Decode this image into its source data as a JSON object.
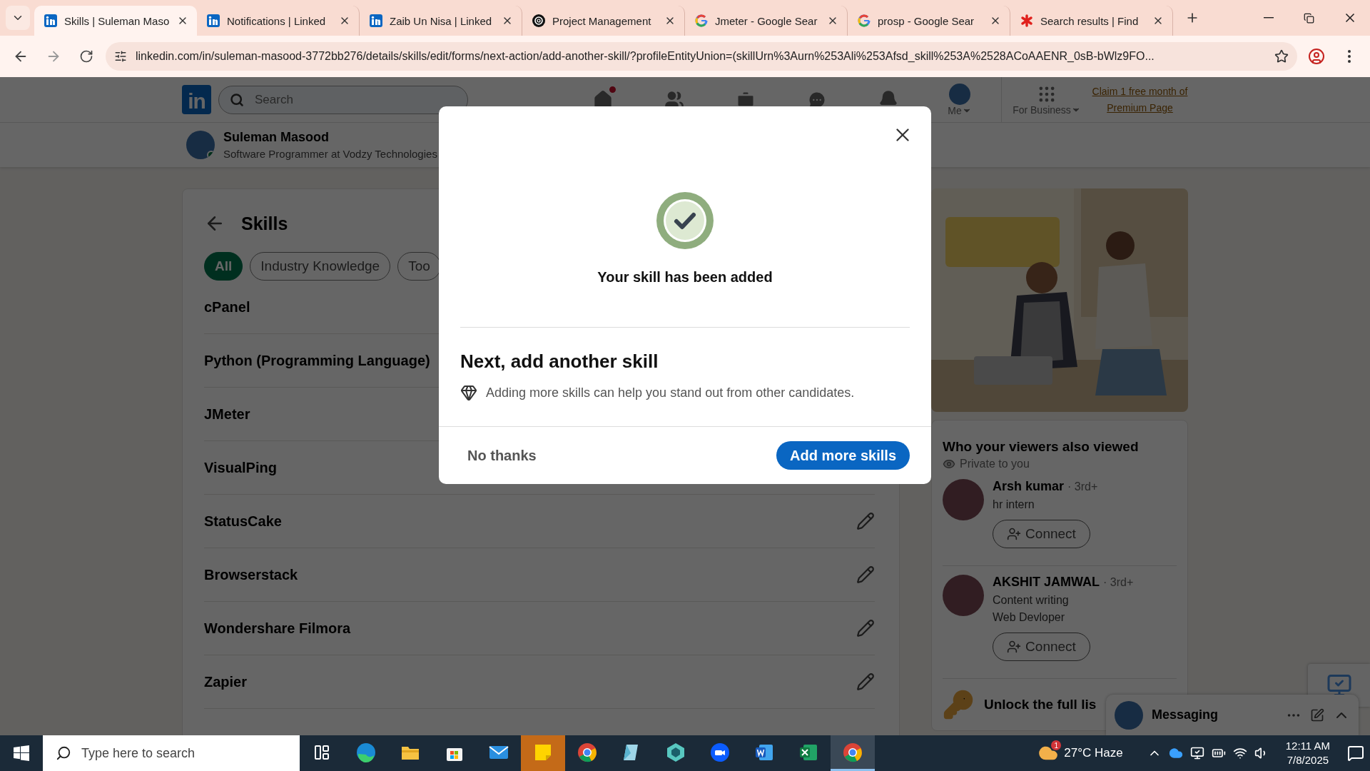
{
  "browser": {
    "tabs": [
      {
        "title": "Skills | Suleman Maso",
        "kind": "linkedin",
        "selected": true
      },
      {
        "title": "Notifications | Linked",
        "kind": "linkedin",
        "selected": false
      },
      {
        "title": "Zaib Un Nisa | Linked",
        "kind": "linkedin",
        "selected": false
      },
      {
        "title": "Project Management",
        "kind": "knot",
        "selected": false
      },
      {
        "title": "Jmeter - Google Sear",
        "kind": "google",
        "selected": false
      },
      {
        "title": "prosp - Google Sear",
        "kind": "google",
        "selected": false
      },
      {
        "title": "Search results | Find",
        "kind": "asterisk",
        "selected": false
      }
    ],
    "url": "linkedin.com/in/suleman-masood-3772bb276/details/skills/edit/forms/next-action/add-another-skill/?profileEntityUnion=(skillUrn%3Aurn%253Ali%253Afsd_skill%253A%2528ACoAAENR_0sB-bWlz9FO..."
  },
  "nav": {
    "logo": "in",
    "search_placeholder": "Search",
    "items": [
      {
        "kind": "home",
        "badge": true
      },
      {
        "kind": "network",
        "badge": false
      },
      {
        "kind": "jobs",
        "badge": false
      },
      {
        "kind": "messaging",
        "badge": false
      },
      {
        "kind": "notifications",
        "badge": false
      }
    ],
    "me": "Me",
    "business": "For Business",
    "premium": "Claim 1 free month of Premium Page"
  },
  "profile": {
    "name": "Suleman Masood",
    "headline": "Software Programmer at Vodzy Technologies",
    "online": true
  },
  "skills": {
    "title": "Skills",
    "filters": [
      {
        "label": "All",
        "selected": true
      },
      {
        "label": "Industry Knowledge",
        "selected": false
      },
      {
        "label": "Too",
        "selected": false
      }
    ],
    "rows": [
      {
        "name": "cPanel"
      },
      {
        "name": "Python (Programming Language)"
      },
      {
        "name": "JMeter"
      },
      {
        "name": "VisualPing"
      },
      {
        "name": "StatusCake",
        "edit_icon": true
      },
      {
        "name": "Browserstack",
        "edit_icon": true
      },
      {
        "name": "Wondershare Filmora",
        "edit_icon": true
      },
      {
        "name": "Zapier",
        "edit_icon": true
      }
    ]
  },
  "modal": {
    "success": "Your skill has been added",
    "heading": "Next, add another skill",
    "hint": "Adding more skills can help you stand out from other candidates.",
    "secondary": "No thanks",
    "primary": "Add more skills"
  },
  "sidebar": {
    "viewers": {
      "title": "Who your viewers also viewed",
      "privacy": "Private to you",
      "people": [
        {
          "name": "Arsh kumar",
          "degree": "· 3rd+",
          "lines": [
            "hr intern"
          ],
          "action": "Connect"
        },
        {
          "name": "AKSHIT JAMWAL",
          "degree": "· 3rd+",
          "lines": [
            "Content writing",
            "Web Devloper"
          ],
          "action": "Connect"
        }
      ],
      "unlock": "Unlock the full lis"
    }
  },
  "messaging": {
    "label": "Messaging"
  },
  "taskbar": {
    "search_placeholder": "Type here to search",
    "apps": [
      {
        "kind": "taskview",
        "selected": false,
        "attention": false
      },
      {
        "kind": "edge",
        "selected": false,
        "attention": false
      },
      {
        "kind": "folder",
        "selected": false,
        "attention": false
      },
      {
        "kind": "store",
        "selected": false,
        "attention": false
      },
      {
        "kind": "mail",
        "selected": false,
        "attention": false
      },
      {
        "kind": "notes",
        "selected": false,
        "attention": true
      },
      {
        "kind": "chrome",
        "selected": false,
        "attention": false
      },
      {
        "kind": "crystal",
        "selected": false,
        "attention": false
      },
      {
        "kind": "gem",
        "selected": false,
        "attention": false
      },
      {
        "kind": "video",
        "selected": false,
        "attention": false
      },
      {
        "kind": "word",
        "selected": false,
        "attention": false
      },
      {
        "kind": "excel",
        "selected": false,
        "attention": false
      },
      {
        "kind": "chrome",
        "selected": true,
        "attention": false
      }
    ],
    "weather": {
      "badge": "1",
      "text": "27°C Haze"
    },
    "time": "12:11 AM",
    "date": "7/8/2025"
  }
}
